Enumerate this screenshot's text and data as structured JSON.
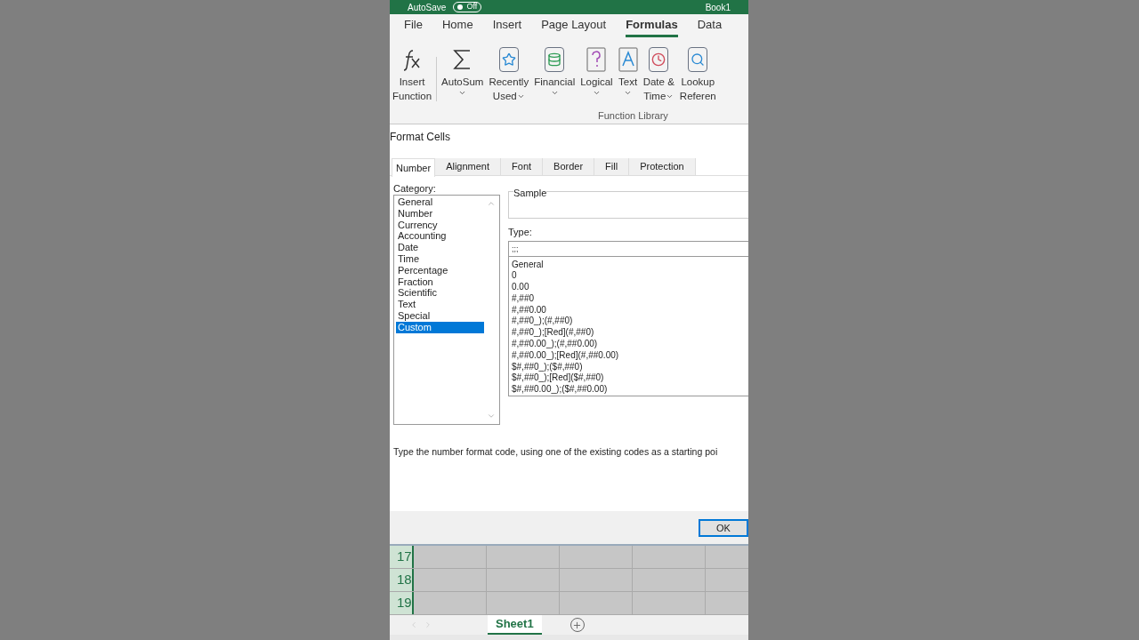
{
  "title_bar": {
    "autosave_label": "AutoSave",
    "autosave_toggle": {
      "label": "Off",
      "on": false
    },
    "file_name": "Book1"
  },
  "ribbon_tabs": [
    {
      "label": "File",
      "selected": false
    },
    {
      "label": "Home",
      "selected": false
    },
    {
      "label": "Insert",
      "selected": false
    },
    {
      "label": "Page Layout",
      "selected": false
    },
    {
      "label": "Formulas",
      "selected": true
    },
    {
      "label": "Data",
      "selected": false
    }
  ],
  "ribbon_buttons": [
    {
      "kind": "fx",
      "lines": [
        "Insert",
        "Function"
      ],
      "menu": false
    },
    {
      "kind": "sum",
      "lines": [
        "AutoSum"
      ],
      "menu": true
    },
    {
      "kind": "star",
      "lines": [
        "Recently",
        "Used"
      ],
      "menu": true
    },
    {
      "kind": "coins",
      "lines": [
        "Financial"
      ],
      "menu": true
    },
    {
      "kind": "question",
      "lines": [
        "Logical"
      ],
      "menu": true
    },
    {
      "kind": "letter",
      "lines": [
        "Text"
      ],
      "menu": true
    },
    {
      "kind": "clock",
      "lines": [
        "Date &",
        "Time"
      ],
      "menu": true
    },
    {
      "kind": "search",
      "lines": [
        "Lookup",
        "Referen"
      ],
      "menu": false
    }
  ],
  "ribbon_group": "Function Library",
  "dialog": {
    "title": "Format Cells",
    "tabs": [
      {
        "label": "Number",
        "selected": true
      },
      {
        "label": "Alignment",
        "selected": false
      },
      {
        "label": "Font",
        "selected": false
      },
      {
        "label": "Border",
        "selected": false
      },
      {
        "label": "Fill",
        "selected": false
      },
      {
        "label": "Protection",
        "selected": false
      }
    ],
    "category_label": "Category:",
    "categories": [
      {
        "label": "General",
        "selected": false
      },
      {
        "label": "Number",
        "selected": false
      },
      {
        "label": "Currency",
        "selected": false
      },
      {
        "label": "Accounting",
        "selected": false
      },
      {
        "label": "Date",
        "selected": false
      },
      {
        "label": "Time",
        "selected": false
      },
      {
        "label": "Percentage",
        "selected": false
      },
      {
        "label": "Fraction",
        "selected": false
      },
      {
        "label": "Scientific",
        "selected": false
      },
      {
        "label": "Text",
        "selected": false
      },
      {
        "label": "Special",
        "selected": false
      },
      {
        "label": "Custom",
        "selected": true
      }
    ],
    "sample_label": "Sample",
    "type_label": "Type:",
    "type_value": ";;;",
    "formats": [
      "General",
      "0",
      "0.00",
      "#,##0",
      "#,##0.00",
      "#,##0_);(#,##0)",
      "#,##0_);[Red](#,##0)",
      "#,##0.00_);(#,##0.00)",
      "#,##0.00_);[Red](#,##0.00)",
      "$#,##0_);($#,##0)",
      "$#,##0_);[Red]($#,##0)",
      "$#,##0.00_);($#,##0.00)"
    ],
    "description": "Type the number format code, using one of the existing codes as a starting poi",
    "buttons": [
      "OK"
    ]
  },
  "row_numbers": [
    "17",
    "18",
    "19"
  ],
  "sheet_tabs": [
    {
      "label": "Sheet1",
      "selected": true
    }
  ]
}
